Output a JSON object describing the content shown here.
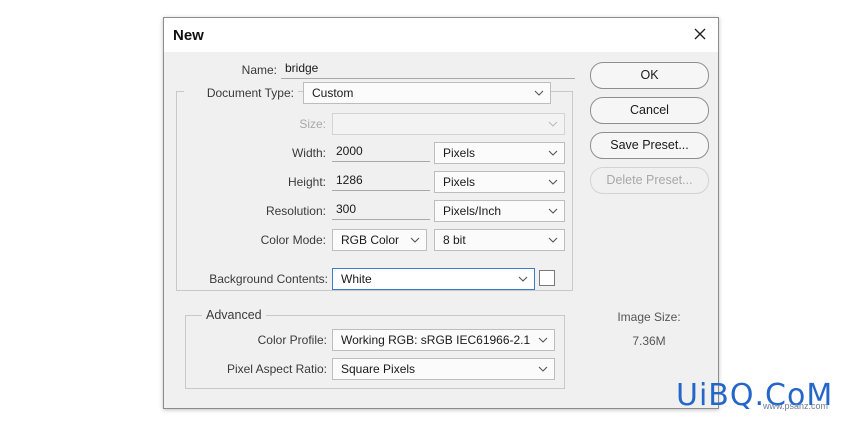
{
  "dialog": {
    "title": "New",
    "name_label": "Name:",
    "name_value": "bridge",
    "doc_type_label": "Document Type:",
    "doc_type_value": "Custom",
    "size_label": "Size:",
    "size_value": "",
    "width_label": "Width:",
    "width_value": "2000",
    "width_unit": "Pixels",
    "height_label": "Height:",
    "height_value": "1286",
    "height_unit": "Pixels",
    "resolution_label": "Resolution:",
    "resolution_value": "300",
    "resolution_unit": "Pixels/Inch",
    "color_mode_label": "Color Mode:",
    "color_mode_value": "RGB Color",
    "bit_depth_value": "8 bit",
    "bg_contents_label": "Background Contents:",
    "bg_contents_value": "White",
    "advanced_label": "Advanced",
    "color_profile_label": "Color Profile:",
    "color_profile_value": "Working RGB:  sRGB IEC61966-2.1",
    "pixel_aspect_label": "Pixel Aspect Ratio:",
    "pixel_aspect_value": "Square Pixels",
    "image_size_label": "Image Size:",
    "image_size_value": "7.36M"
  },
  "buttons": {
    "ok": "OK",
    "cancel": "Cancel",
    "save_preset": "Save Preset...",
    "delete_preset": "Delete Preset..."
  },
  "watermark": {
    "logo": "UiBQ.CoM",
    "url": "www.psahz.com"
  },
  "colors": {
    "dialog_bg": "#f0f0f0",
    "focus_border": "#3d7cc9",
    "watermark": "#2467c8"
  }
}
